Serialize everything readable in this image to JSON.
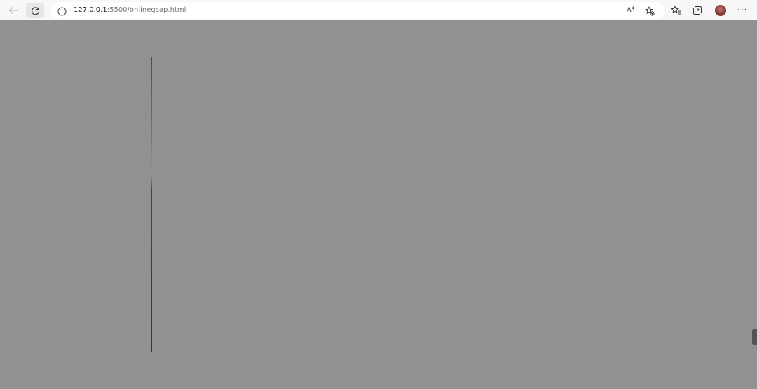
{
  "browser": {
    "address_bar": {
      "host": "127.0.0.1",
      "path": ":5500/onlinegsap.html"
    },
    "read_aloud_label": "A⁴",
    "more_label": "···"
  },
  "colors": {
    "toolbar_bg": "#f7f7f7",
    "viewport_bg": "#929092",
    "line_color": "#3a3434"
  }
}
